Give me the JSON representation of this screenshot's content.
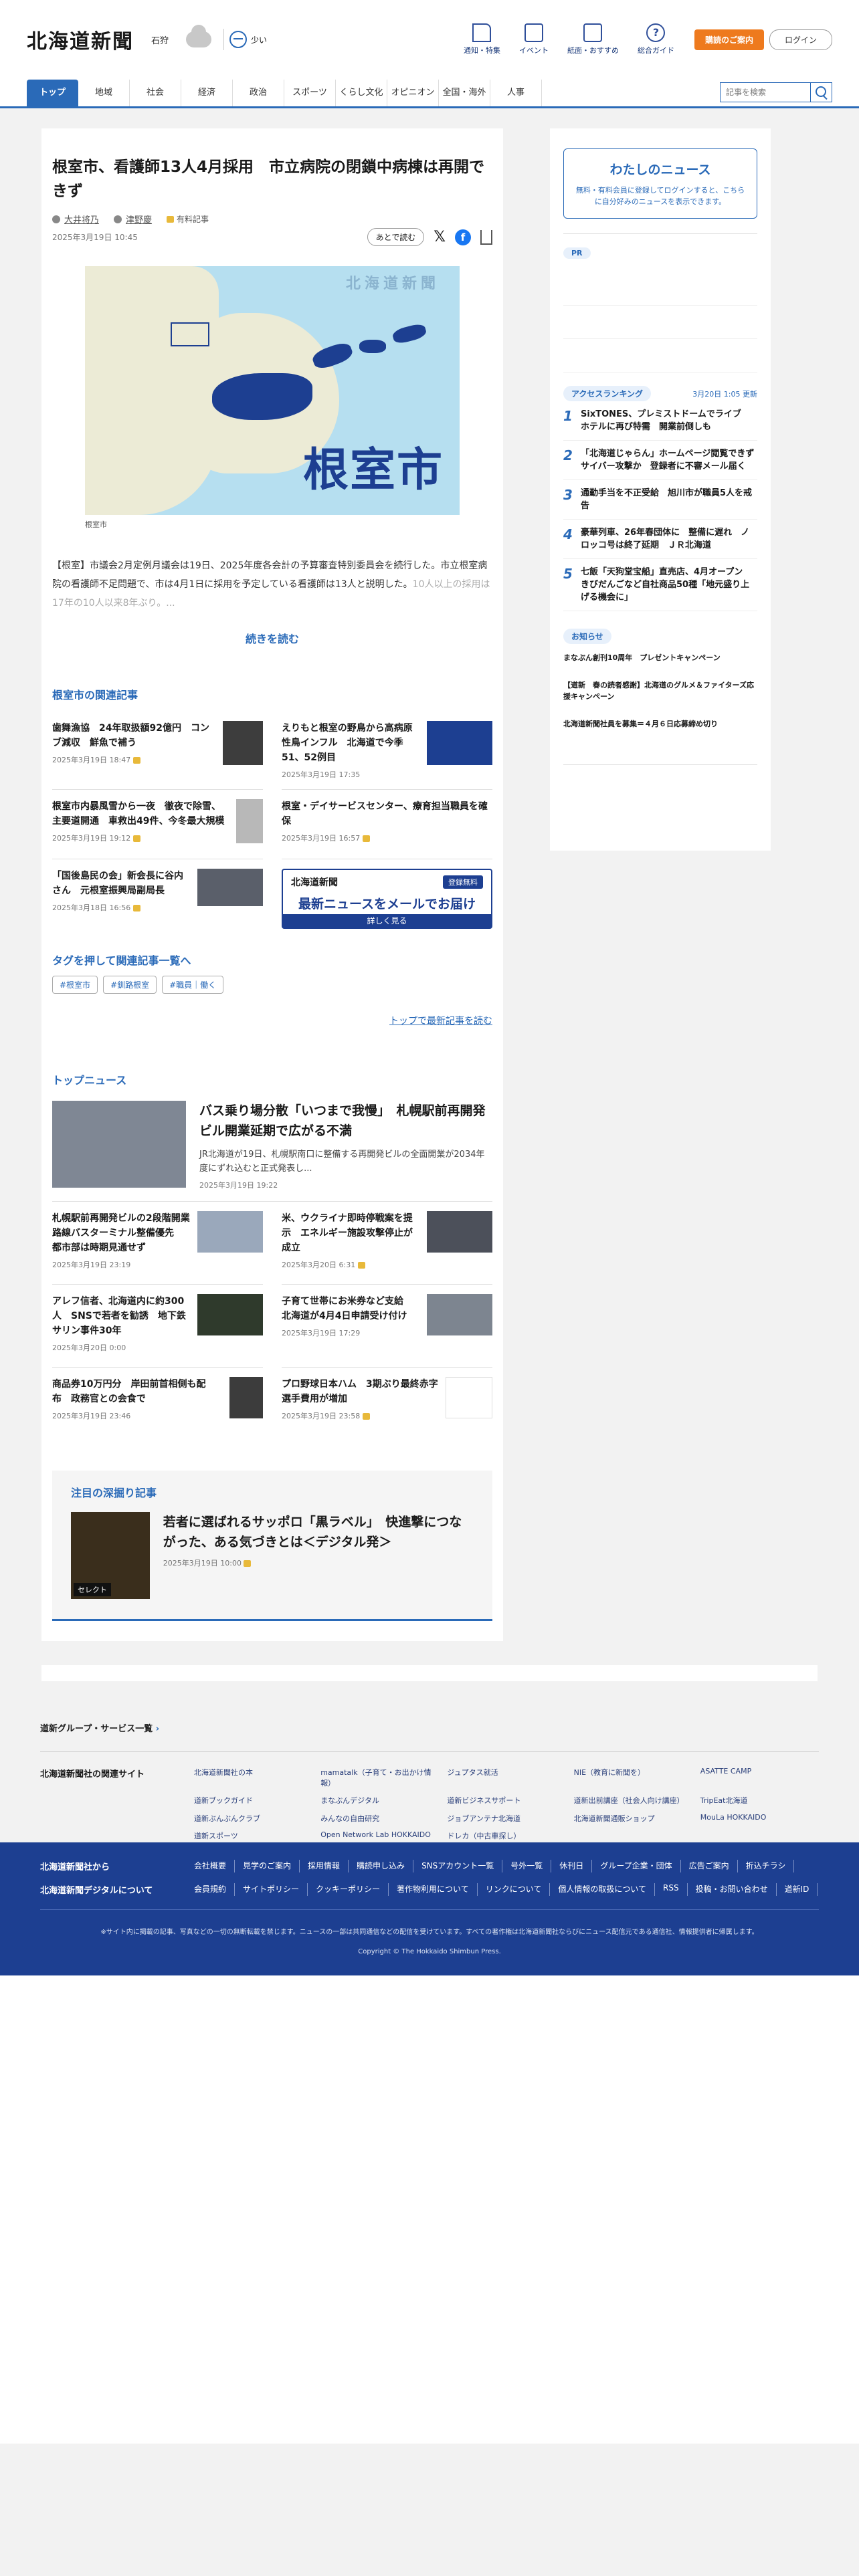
{
  "header": {
    "logo": "北海道新聞",
    "region": "石狩",
    "pollen": "少い",
    "icons": [
      {
        "label": "通知・特集"
      },
      {
        "label": "イベント"
      },
      {
        "label": "紙面・おすすめ"
      },
      {
        "label": "総合ガイド"
      }
    ],
    "member_button": "購読のご案内",
    "login_button": "ログイン"
  },
  "nav": {
    "items": [
      "トップ",
      "地域",
      "社会",
      "経済",
      "政治",
      "スポーツ",
      "くらし文化",
      "オピニオン",
      "全国・海外",
      "人事"
    ],
    "search_placeholder": "記事を検索"
  },
  "article": {
    "title": "根室市、看護師13人4月採用　市立病院の閉鎖中病棟は再開できず",
    "authors": [
      "大井将乃",
      "津野慶"
    ],
    "paid_label": "有料記事",
    "date": "2025年3月19日 10:45",
    "read_later": "あとで読む",
    "map": {
      "watermark": "北海道新聞",
      "place": "根室市"
    },
    "caption": "根室市",
    "lead": "【根室】市議会2月定例月議会は19日、2025年度各会計の予算審査特別委員会を続行した。市立根室病院の看護師不足問題で、市は4月1日に採用を予定している看護師は13人と説明した。",
    "lead_fade": "10人以上の採用は17年の10人以来8年ぶり。...",
    "read_more": "続きを読む"
  },
  "related": {
    "title": "根室市の関連記事",
    "items": [
      {
        "headline": "歯舞漁協　24年取扱額92億円　コンブ減収　鮮魚で補う",
        "date": "2025年3月19日 18:47",
        "paid": true
      },
      {
        "headline": "えりもと根室の野鳥から高病原性鳥インフル　北海道で今季51、52例目",
        "date": "2025年3月19日 17:35",
        "paid": false
      },
      {
        "headline": "根室市内暴風雪から一夜　徹夜で除雪、主要道開通　車救出49件、今冬最大規模",
        "date": "2025年3月19日 19:12",
        "paid": true
      },
      {
        "headline": "根室・デイサービスセンター、療育担当職員を確保",
        "date": "2025年3月19日 16:57",
        "paid": true
      },
      {
        "headline": "「国後島民の会」新会長に谷内さん　元根室振興局副局長",
        "date": "2025年3月18日 16:56",
        "paid": true
      }
    ],
    "ad": {
      "logo": "北海道新聞",
      "badge": "登録無料",
      "main": "最新ニュースをメールでお届け",
      "cta": "詳しく見る"
    }
  },
  "tags": {
    "title": "タグを押して関連記事一覧へ",
    "items": [
      "#根室市",
      "#釧路根室",
      "#職員｜働く"
    ]
  },
  "to_top": "トップで最新記事を読む",
  "top_news": {
    "title": "トップニュース",
    "hero": {
      "headline": "バス乗り場分散「いつまで我慢」　札幌駅前再開発ビル開業延期で広がる不満",
      "summary": "JR北海道が19日、札幌駅南口に整備する再開発ビルの全面開業が2034年度にずれ込むと正式発表し...",
      "date": "2025年3月19日 19:22"
    },
    "items": [
      {
        "headline": "札幌駅前再開発ビルの2段階開業　路線バスターミナル整備優先　都市部は時期見通せず",
        "date": "2025年3月19日 23:19",
        "paid": false
      },
      {
        "headline": "米、ウクライナ即時停戦案を提示　エネルギー施設攻撃停止が成立",
        "date": "2025年3月20日 6:31",
        "paid": true
      },
      {
        "headline": "アレフ信者、北海道内に約300人　SNSで若者を勧誘　地下鉄サリン事件30年",
        "date": "2025年3月20日 0:00",
        "paid": false
      },
      {
        "headline": "子育て世帯にお米券など支給　北海道が4月4日申請受け付け",
        "date": "2025年3月19日 17:29",
        "paid": false
      },
      {
        "headline": "商品券10万円分　岸田前首相側も配布　政務官との会食で",
        "date": "2025年3月19日 23:46",
        "paid": false
      },
      {
        "headline": "プロ野球日本ハム　3期ぶり最終赤字　選手費用が増加",
        "date": "2025年3月19日 23:58",
        "paid": true
      }
    ]
  },
  "feature": {
    "title": "注目の深掘り記事",
    "badge": "セレクト",
    "headline": "若者に選ばれるサッポロ「黒ラベル」　快進撃につながった、ある気づきとは＜デジタル発＞",
    "date": "2025年3月19日 10:00"
  },
  "sidebar": {
    "mynews_title": "わたしのニュース",
    "mynews_text": "無料・有料会員に登録してログインすると、こちらに自分好みのニュースを表示できます。",
    "pr": "PR",
    "ranking_title": "アクセスランキング",
    "ranking_updated": "3月20日 1:05 更新",
    "ranking": [
      {
        "n": "1",
        "headline": "SixTONES、プレミストドームでライブ　ホテルに再び特需　開業前倒しも"
      },
      {
        "n": "2",
        "headline": "「北海道じゃらん」ホームページ閲覧できず　サイバー攻撃か　登録者に不審メール届く"
      },
      {
        "n": "3",
        "headline": "通勤手当を不正受給　旭川市が職員5人を戒告"
      },
      {
        "n": "4",
        "headline": "豪華列車、26年春団体に　整備に遅れ　ノロッコ号は終了延期　ＪＲ北海道"
      },
      {
        "n": "5",
        "headline": "七飯「天狗堂宝船」直売店、4月オープン　きびだんごなど自社商品50種「地元盛り上げる機会に」"
      }
    ],
    "notice_title": "お知らせ",
    "notices": [
      "まなぶん創刊10周年　プレゼントキャンペーン",
      "【道新　春の読者感謝】北海道のグルメ＆ファイターズ応援キャンペーン",
      "北海道新聞社員を募集＝４月６日応募締め切り"
    ]
  },
  "footer": {
    "group_link": "道新グループ・サービス一覧",
    "sites_label": "北海道新聞社の関連サイト",
    "sites": [
      "北海道新聞社の本",
      "mamatalk（子育て・お出かけ情報）",
      "ジュプタス就活",
      "NIE（教育に新聞を）",
      "ASATTE CAMP",
      "道新ブックガイド",
      "まなぶんデジタル",
      "道新ビジネスサポート",
      "道新出前講座（社会人向け講座）",
      "TripEat北海道",
      "道新ぶんぶんクラブ",
      "みんなの自由研究",
      "ジョブアンテナ北海道",
      "北海道新聞通販ショップ",
      "MouLa HOKKAIDO",
      "道新スポーツ",
      "Open Network Lab HOKKAIDO",
      "ドレカ（中古車探し）",
      "",
      ""
    ],
    "company_label": "北海道新聞社から",
    "company_links": [
      "会社概要",
      "見学のご案内",
      "採用情報",
      "購読申し込み",
      "SNSアカウント一覧",
      "号外一覧",
      "休刊日",
      "グループ企業・団体",
      "広告ご案内",
      "折込チラシ"
    ],
    "digital_label": "北海道新聞デジタルについて",
    "digital_links": [
      "会員規約",
      "サイトポリシー",
      "クッキーポリシー",
      "著作物利用について",
      "リンクについて",
      "個人情報の取扱について",
      "RSS",
      "投稿・お問い合わせ",
      "道新ID"
    ],
    "notice": "※サイト内に掲載の記事、写真などの一切の無断転載を禁じます。ニュースの一部は共同通信などの配信を受けています。すべての著作権は北海道新聞社ならびにニュース配信元である通信社、情報提供者に帰属します。",
    "copyright": "Copyright © The Hokkaido Shimbun Press."
  }
}
